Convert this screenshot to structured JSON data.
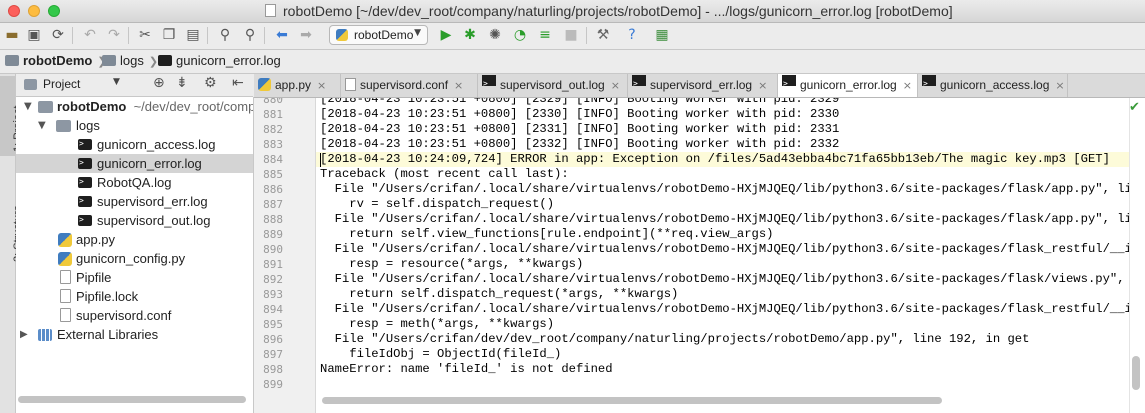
{
  "window": {
    "title": "robotDemo [~/dev/dev_root/company/naturling/projects/robotDemo] - .../logs/gunicorn_error.log [robotDemo]"
  },
  "toolbar": {
    "run_config": "robotDemo"
  },
  "breadcrumb": [
    "robotDemo",
    "logs",
    "gunicorn_error.log"
  ],
  "side_tabs": [
    "1: Project",
    "2: Structure"
  ],
  "project_panel": {
    "view_mode": "Project"
  },
  "tree": {
    "root_name": "robotDemo",
    "root_path": "~/dev/dev_root/company/naturling/projects/robotDemo",
    "logs_folder": "logs",
    "log_files": [
      "gunicorn_access.log",
      "gunicorn_error.log",
      "RobotQA.log",
      "supervisord_err.log",
      "supervisord_out.log"
    ],
    "root_files": [
      "app.py",
      "gunicorn_config.py",
      "Pipfile",
      "Pipfile.lock",
      "supervisord.conf"
    ],
    "external": "External Libraries"
  },
  "tabs": [
    "app.py",
    "supervisord.conf",
    "supervisord_out.log",
    "supervisord_err.log",
    "gunicorn_error.log",
    "gunicorn_access.log"
  ],
  "editor": {
    "first_line_number": 880,
    "highlighted_line": 884,
    "lines": [
      "[2018-04-23 10:23:51 +0800] [2329] [INFO] Booting worker with pid: 2329",
      "[2018-04-23 10:23:51 +0800] [2330] [INFO] Booting worker with pid: 2330",
      "[2018-04-23 10:23:51 +0800] [2331] [INFO] Booting worker with pid: 2331",
      "[2018-04-23 10:23:51 +0800] [2332] [INFO] Booting worker with pid: 2332",
      "[2018-04-23 10:24:09,724] ERROR in app: Exception on /files/5ad43ebba4bc71fa65bb13eb/The magic key.mp3 [GET]",
      "Traceback (most recent call last):",
      "  File \"/Users/crifan/.local/share/virtualenvs/robotDemo-HXjMJQEQ/lib/python3.6/site-packages/flask/app.py\", line 1612, in full_dispatch_request",
      "    rv = self.dispatch_request()",
      "  File \"/Users/crifan/.local/share/virtualenvs/robotDemo-HXjMJQEQ/lib/python3.6/site-packages/flask/app.py\", line 1598, in dispatch_request",
      "    return self.view_functions[rule.endpoint](**req.view_args)",
      "  File \"/Users/crifan/.local/share/virtualenvs/robotDemo-HXjMJQEQ/lib/python3.6/site-packages/flask_restful/__init__.py\", line 480, in wrapper",
      "    resp = resource(*args, **kwargs)",
      "  File \"/Users/crifan/.local/share/virtualenvs/robotDemo-HXjMJQEQ/lib/python3.6/site-packages/flask/views.py\", line 84, in view",
      "    return self.dispatch_request(*args, **kwargs)",
      "  File \"/Users/crifan/.local/share/virtualenvs/robotDemo-HXjMJQEQ/lib/python3.6/site-packages/flask_restful/__init__.py\", line 595, in dispatch_request",
      "    resp = meth(*args, **kwargs)",
      "  File \"/Users/crifan/dev/dev_root/company/naturling/projects/robotDemo/app.py\", line 192, in get",
      "    fileIdObj = ObjectId(fileId_)",
      "NameError: name 'fileId_' is not defined",
      ""
    ]
  }
}
